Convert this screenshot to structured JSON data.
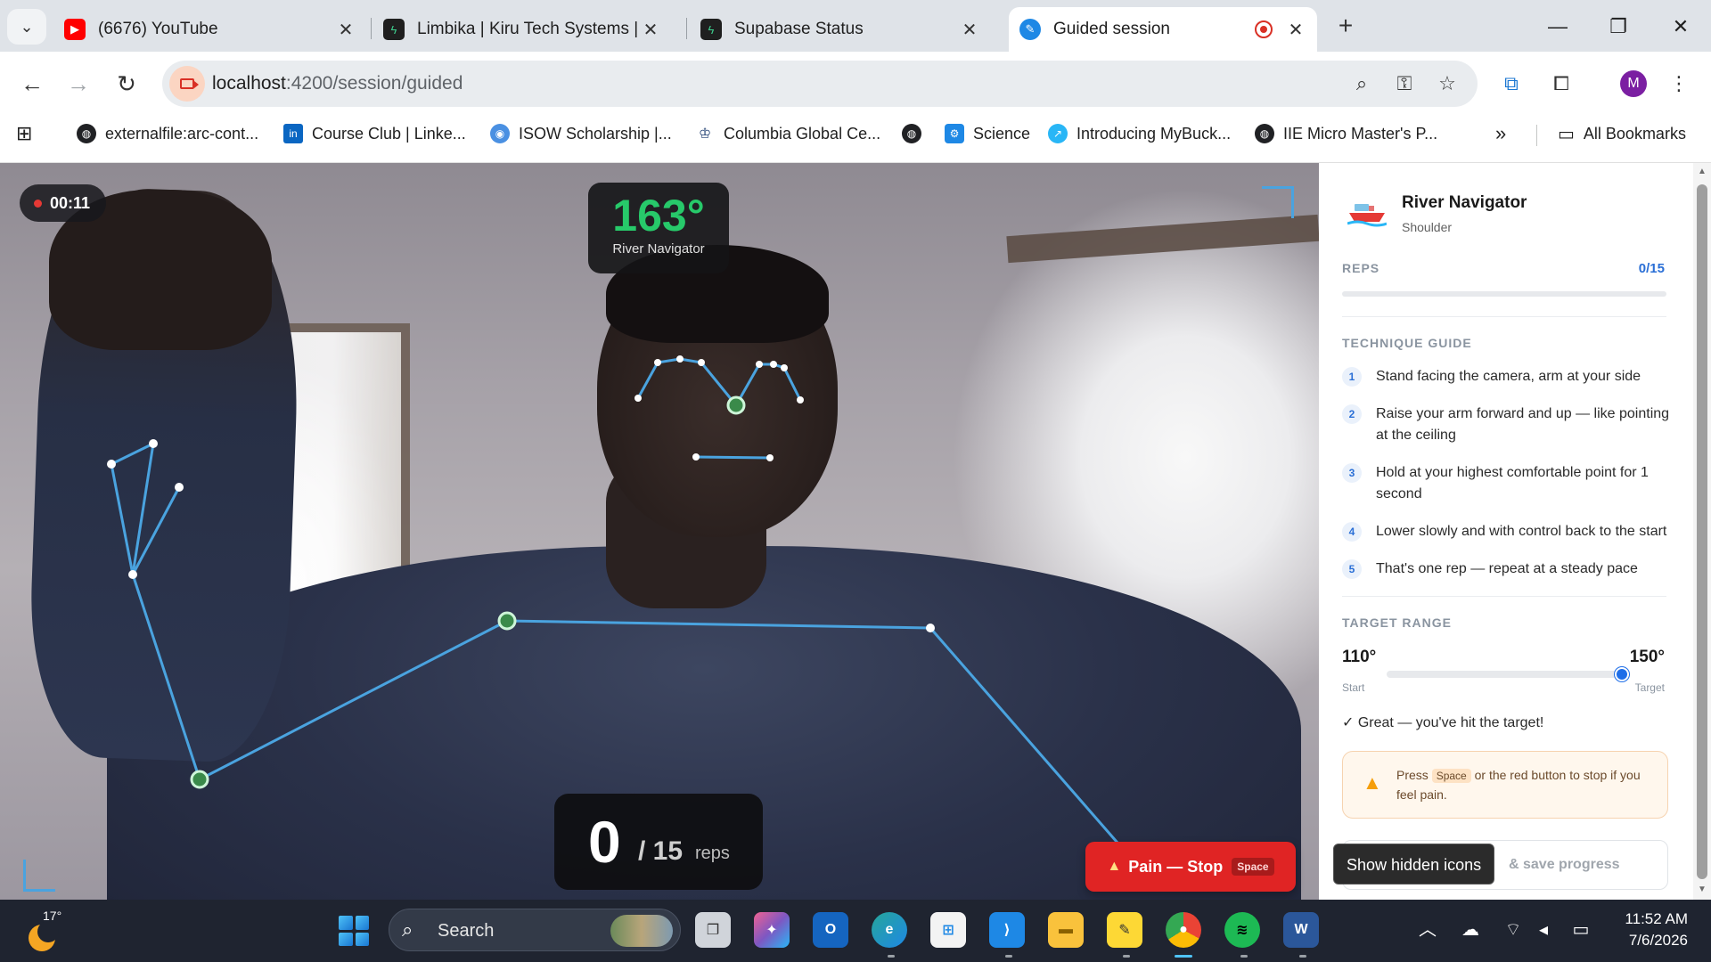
{
  "browser": {
    "tabs": [
      {
        "title": "(6676) YouTube",
        "favicon": "youtube-icon",
        "color": "#ff0000"
      },
      {
        "title": "Limbika | Kiru Tech Systems | Su",
        "favicon": "supabase-icon",
        "color": "#1f1f1f"
      },
      {
        "title": "Supabase Status",
        "favicon": "supabase-icon",
        "color": "#1f1f1f"
      },
      {
        "title": "Guided session",
        "favicon": "app-icon",
        "color": "#1e88e5",
        "active": true
      }
    ],
    "url_host": "localhost",
    "url_path": ":4200/session/guided",
    "profile_initial": "M",
    "bookmarks": [
      "externalfile:arc-cont...",
      "Course Club | Linke...",
      "ISOW Scholarship |...",
      "Columbia Global Ce...",
      "",
      "Science",
      "Introducing MyBuck...",
      "IIE Micro Master's P..."
    ],
    "all_bookmarks": "All Bookmarks"
  },
  "session": {
    "timer": "00:11",
    "angle": "163°",
    "angle_label": "River Navigator",
    "reps_count": "0",
    "reps_total": "/ 15",
    "reps_unit": "reps",
    "pain_button": "Pain — Stop",
    "pain_key": "Space"
  },
  "panel": {
    "exercise_title": "River Navigator",
    "exercise_subtitle": "Shoulder",
    "reps_label": "REPS",
    "reps_value": "0/15",
    "reps_progress": 0,
    "technique_label": "TECHNIQUE GUIDE",
    "steps": [
      {
        "n": "1",
        "text": "Stand facing the camera, arm at your side"
      },
      {
        "n": "2",
        "text": "Raise your arm forward and up — like pointing at the ceiling"
      },
      {
        "n": "3",
        "text": "Hold at your highest comfortable point for 1 second"
      },
      {
        "n": "4",
        "text": "Lower slowly and with control back to the start"
      },
      {
        "n": "5",
        "text": "That's one rep — repeat at a steady pace"
      }
    ],
    "target_label": "TARGET RANGE",
    "range_start": "110°",
    "range_end": "150°",
    "range_start_caption": "Start",
    "range_end_caption": "Target",
    "range_position": 1.0,
    "status_message": "✓ Great — you've hit the target!",
    "warn_press": "Press",
    "warn_key": "Space",
    "warn_rest": "or the red button to stop if you feel pain.",
    "save_label": "& save progress",
    "tooltip": "Show hidden icons"
  },
  "taskbar": {
    "temperature": "17°",
    "search_placeholder": "Search",
    "time": "11:52 AM",
    "date": "7/6/2026"
  },
  "colors": {
    "accent": "#2a6fd6",
    "angle_green": "#27c96a",
    "pain_red": "#e02424",
    "skeleton_line": "#4aa3df"
  }
}
